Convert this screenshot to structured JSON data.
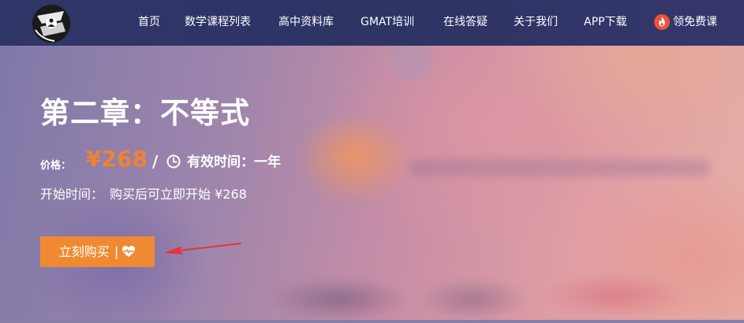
{
  "nav": {
    "items": [
      {
        "label": "首页"
      },
      {
        "label": "数学课程列表"
      },
      {
        "label": "高中资料库"
      },
      {
        "label": "GMAT培训"
      },
      {
        "label": "在线答疑"
      },
      {
        "label": "关于我们"
      },
      {
        "label": "APP下载"
      },
      {
        "label": "领免费课",
        "icon": "fire-icon"
      }
    ]
  },
  "course": {
    "title": "第二章：不等式",
    "price_label": "价格：",
    "price": "¥268",
    "slash": "/",
    "validity_icon": "clock-icon",
    "validity": "有效时间：一年",
    "start_label": "开始时间：",
    "start_value": "购买后可立即开始 ¥268"
  },
  "actions": {
    "buy_label": "立刻购买",
    "buy_separator": "|",
    "buy_icon": "heart-pulse-icon"
  },
  "colors": {
    "navbar": "#2f3566",
    "accent_orange": "#f08a32",
    "annotation_red": "#e8333a"
  }
}
